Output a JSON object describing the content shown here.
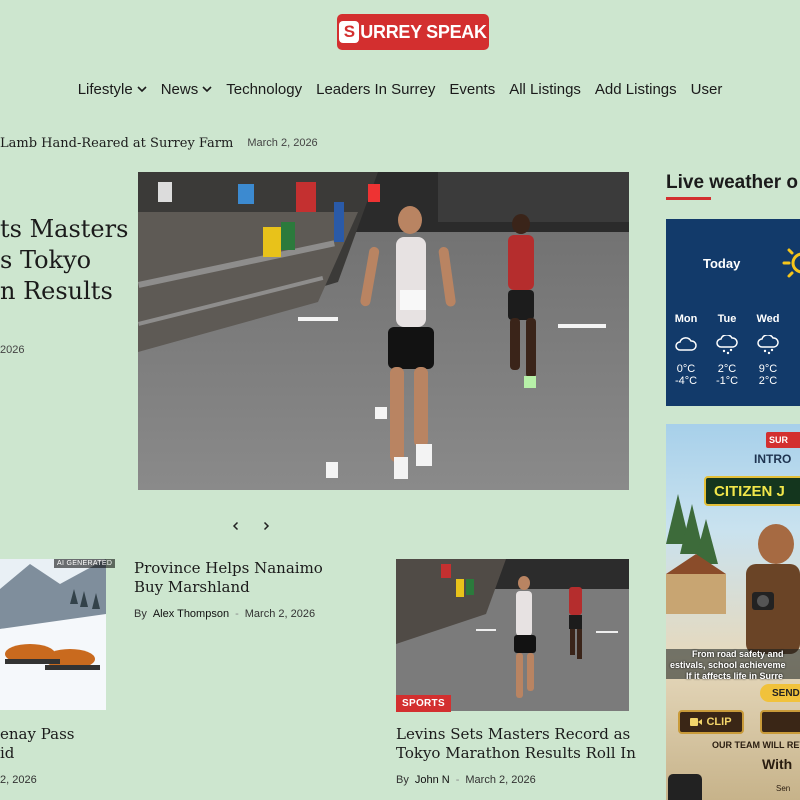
{
  "header": {
    "logo_text": "URREY SPEAK",
    "logo_mark": "S"
  },
  "nav": {
    "items": [
      {
        "label": "Lifestyle",
        "dropdown": true
      },
      {
        "label": "News",
        "dropdown": true
      },
      {
        "label": "Technology",
        "dropdown": false
      },
      {
        "label": "Leaders In Surrey",
        "dropdown": false
      },
      {
        "label": "Events",
        "dropdown": false
      },
      {
        "label": "All Listings",
        "dropdown": false
      },
      {
        "label": "Add Listings",
        "dropdown": false
      },
      {
        "label": "User",
        "dropdown": false
      }
    ]
  },
  "ticker": {
    "title": "Lamb Hand-Reared at Surrey Farm",
    "date": "March 2, 2026"
  },
  "hero": {
    "title_lines": [
      "ts Masters",
      "s Tokyo",
      "n Results"
    ],
    "date": "2026"
  },
  "cards": [
    {
      "title_lines": [
        "enay Pass",
        "id"
      ],
      "date": "2, 2026",
      "ai_label": "AI GENERATED"
    },
    {
      "title": "Province Helps Nanaimo Buy Marshland",
      "by": "By",
      "author": "Alex Thompson",
      "date": "March 2, 2026"
    },
    {
      "title": "Levins Sets Masters Record as Tokyo Marathon Results Roll In",
      "by": "By",
      "author": "John N",
      "date": "March 2, 2026",
      "badge": "SPORTS"
    }
  ],
  "sidebar": {
    "widget_title": "Live weather o",
    "weather": {
      "today_label": "Today",
      "days": [
        {
          "name": "Mon",
          "icon": "cloud-icon",
          "hi": "0°C",
          "lo": "-4°C"
        },
        {
          "name": "Tue",
          "icon": "snow-cloud-icon",
          "hi": "2°C",
          "lo": "-1°C"
        },
        {
          "name": "Wed",
          "icon": "snow-cloud-icon",
          "hi": "9°C",
          "lo": "2°C"
        }
      ]
    },
    "ad": {
      "logo": "SUR",
      "intro": "INTRO",
      "headline": "CITIZEN J",
      "line1": "From road safety and",
      "line2": "estivals, school achieveme",
      "line3": "If it affects life in Surre",
      "send": "SEND",
      "clip": "CLIP",
      "review": "OUR TEAM WILL REVI",
      "with": "With",
      "sent": "Sen"
    }
  },
  "colors": {
    "accent": "#d32f2f",
    "background": "#cde6cf",
    "weather_bg": "#123a6a"
  }
}
